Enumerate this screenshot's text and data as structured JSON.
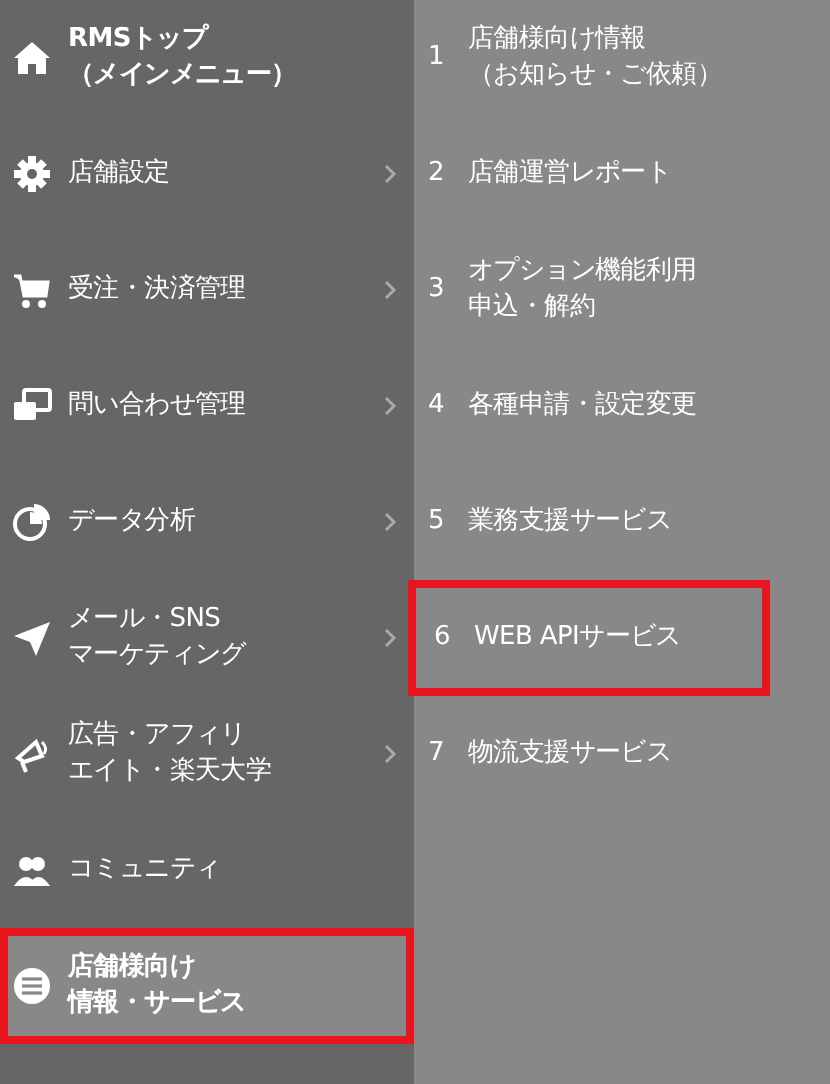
{
  "main_menu": [
    {
      "kind": "top",
      "lines": [
        "RMSトップ",
        "（メインメニュー）"
      ],
      "has_submenu": false,
      "selected": false,
      "highlighted": false
    },
    {
      "kind": "item",
      "lines": [
        "店舗設定"
      ],
      "has_submenu": true,
      "selected": false,
      "highlighted": false
    },
    {
      "kind": "item",
      "lines": [
        "受注・決済管理"
      ],
      "has_submenu": true,
      "selected": false,
      "highlighted": false
    },
    {
      "kind": "item",
      "lines": [
        "問い合わせ管理"
      ],
      "has_submenu": true,
      "selected": false,
      "highlighted": false
    },
    {
      "kind": "item",
      "lines": [
        "データ分析"
      ],
      "has_submenu": true,
      "selected": false,
      "highlighted": false
    },
    {
      "kind": "item",
      "lines": [
        "メール・SNS",
        "マーケティング"
      ],
      "has_submenu": true,
      "selected": false,
      "highlighted": false
    },
    {
      "kind": "item",
      "lines": [
        "広告・アフィリ",
        "エイト・楽天大学"
      ],
      "has_submenu": true,
      "selected": false,
      "highlighted": false
    },
    {
      "kind": "item",
      "lines": [
        "コミュニティ"
      ],
      "has_submenu": false,
      "selected": false,
      "highlighted": false
    },
    {
      "kind": "item",
      "lines": [
        "店舗様向け",
        "情報・サービス"
      ],
      "has_submenu": false,
      "selected": true,
      "highlighted": true
    }
  ],
  "submenu": [
    {
      "number": "1",
      "lines": [
        "店舗様向け情報",
        "（お知らせ・ご依頼）"
      ],
      "highlighted": false
    },
    {
      "number": "2",
      "lines": [
        "店舗運営レポート"
      ],
      "highlighted": false
    },
    {
      "number": "3",
      "lines": [
        "オプション機能利用",
        "申込・解約"
      ],
      "highlighted": false
    },
    {
      "number": "4",
      "lines": [
        "各種申請・設定変更"
      ],
      "highlighted": false
    },
    {
      "number": "5",
      "lines": [
        "業務支援サービス"
      ],
      "highlighted": false
    },
    {
      "number": "6",
      "lines": [
        "WEB APIサービス"
      ],
      "highlighted": true
    },
    {
      "number": "7",
      "lines": [
        "物流支援サービス"
      ],
      "highlighted": false
    }
  ]
}
